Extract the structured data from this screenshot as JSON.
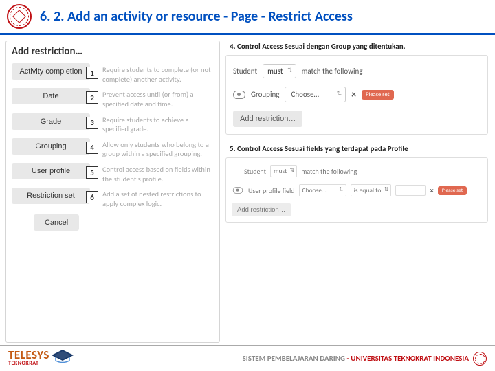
{
  "header": {
    "title": "6. 2. Add an activity or resource - Page - Restrict Access"
  },
  "leftPanel": {
    "heading": "Add restriction…",
    "items": [
      {
        "btn": "Activity completion",
        "num": "1",
        "desc": "Require students to complete (or not complete) another activity."
      },
      {
        "btn": "Date",
        "num": "2",
        "desc": "Prevent access until (or from) a specified date and time."
      },
      {
        "btn": "Grade",
        "num": "3",
        "desc": "Require students to achieve a specified grade."
      },
      {
        "btn": "Grouping",
        "num": "4",
        "desc": "Allow only students who belong to a group within a specified grouping."
      },
      {
        "btn": "User profile",
        "num": "5",
        "desc": "Control access based on fields within the student's profile."
      },
      {
        "btn": "Restriction set",
        "num": "6",
        "desc": "Add a set of nested restrictions to apply complex logic."
      }
    ],
    "cancel": "Cancel"
  },
  "step4": {
    "label": "4. Control Access Sesuai dengan Group yang ditentukan.",
    "student": "Student",
    "must": "must",
    "match": "match the following",
    "grouping": "Grouping",
    "choose": "Choose…",
    "warn": "Please set",
    "addRestriction": "Add restriction…"
  },
  "step5": {
    "label": "5. Control Access Sesuai fields yang terdapat pada Profile",
    "student": "Student",
    "must": "must",
    "match": "match the following",
    "upf": "User profile field",
    "choose": "Choose…",
    "eq": "is equal to",
    "warn": "Please set",
    "addRestriction": "Add restriction…"
  },
  "footer": {
    "brand": "TELESYS",
    "brandSub": "TEKNOKRAT",
    "text1": "SISTEM PEMBELAJARAN DARING ",
    "text2": "- UNIVERSITAS TEKNOKRAT INDONESIA"
  }
}
